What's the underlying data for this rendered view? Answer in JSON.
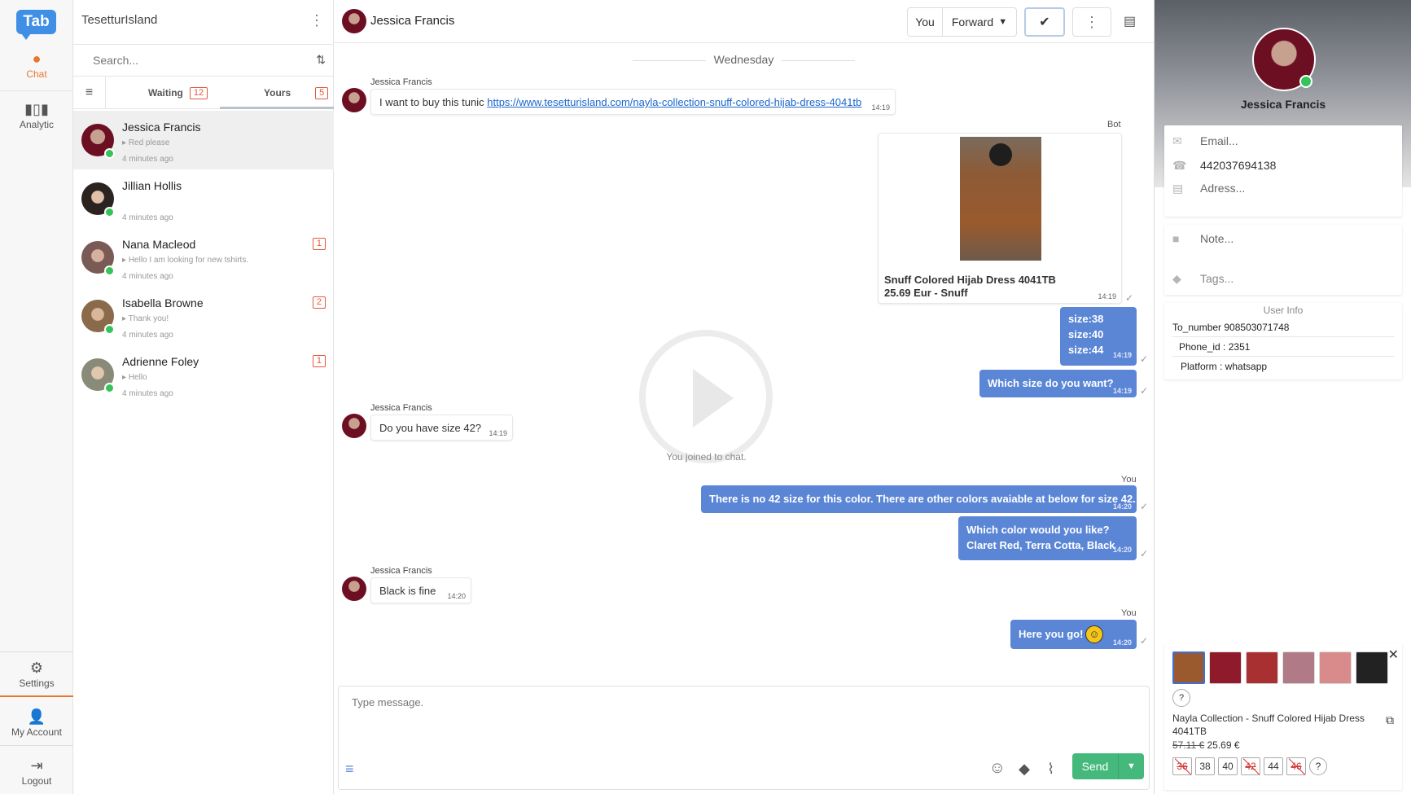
{
  "app": {
    "logo_text": "Tab"
  },
  "nav": {
    "chat": "Chat",
    "analytic": "Analytic",
    "settings": "Settings",
    "my_account": "My Account",
    "logout": "Logout"
  },
  "list": {
    "workspace": "TesetturIsland",
    "search_placeholder": "Search...",
    "tabs": [
      {
        "label": "Waiting",
        "count": "12"
      },
      {
        "label": "Yours",
        "count": "5"
      }
    ],
    "conversations": [
      {
        "name": "Jessica Francis",
        "preview": "Red please",
        "time": "4 minutes ago",
        "badge": ""
      },
      {
        "name": "Jillian Hollis",
        "preview": "",
        "time": "4 minutes ago",
        "badge": ""
      },
      {
        "name": "Nana Macleod",
        "preview": "Hello I am looking for new tshirts.",
        "time": "4 minutes ago",
        "badge": "1"
      },
      {
        "name": "Isabella Browne",
        "preview": "Thank you!",
        "time": "4 minutes ago",
        "badge": "2"
      },
      {
        "name": "Adrienne Foley",
        "preview": "Hello",
        "time": "4 minutes ago",
        "badge": "1"
      }
    ]
  },
  "chat": {
    "contact_name": "Jessica Francis",
    "assign_you": "You",
    "forward": "Forward",
    "day": "Wednesday",
    "joined": "You joined to chat.",
    "messages": {
      "m1_sender": "Jessica Francis",
      "m1_text": "I want to buy this tunic ",
      "m1_link": "https://www.tesetturisland.com/nayla-collection-snuff-colored-hijab-dress-4041tb",
      "m1_time": "14:19",
      "bot_label": "Bot",
      "product_name": "Snuff Colored Hijab Dress 4041TB",
      "product_price": "25.69 Eur - Snuff",
      "product_time": "14:19",
      "sizes_1": "size:38",
      "sizes_2": "size:40",
      "sizes_3": "size:44",
      "sizes_time": "14:19",
      "which_size": "Which size do you want?",
      "which_size_time": "14:19",
      "m2_sender": "Jessica Francis",
      "m2_text": "Do you have size 42?",
      "m2_time": "14:19",
      "you_label_1": "You",
      "no42": "There is no 42 size for this color. There are other colors avaiable at below for size 42.",
      "no42_time": "14:20",
      "which_color_1": "Which color would you like?",
      "which_color_2": "Claret Red, Terra Cotta, Black",
      "which_color_time": "14:20",
      "m3_sender": "Jessica Francis",
      "m3_text": "Black is fine",
      "m3_time": "14:20",
      "you_label_2": "You",
      "here": "Here you go!",
      "here_time": "14:20"
    },
    "composer_placeholder": "Type message.",
    "send": "Send"
  },
  "profile": {
    "name": "Jessica Francis",
    "email_placeholder": "Email...",
    "phone": "442037694138",
    "address_placeholder": "Adress...",
    "note_placeholder": "Note...",
    "tags_placeholder": "Tags...",
    "user_info_title": "User Info",
    "to_number": "To_number  908503071748",
    "phone_id": "Phone_id :  2351",
    "platform": "Platform :  whatsapp"
  },
  "product": {
    "title": "Nayla Collection - Snuff Colored Hijab Dress 4041TB",
    "old_price": "57.11 €",
    "new_price": " 25.69 €",
    "sizes": [
      "36",
      "38",
      "40",
      "42",
      "44",
      "46"
    ],
    "unavailable": [
      "36",
      "42",
      "46"
    ],
    "swatches": [
      "#9a5a2e",
      "#8e1a2c",
      "#a83030",
      "#b07a86",
      "#d98a8a",
      "#222222"
    ]
  },
  "colors": {
    "accent": "#e8772e",
    "bubble_out": "#5b86d6",
    "send": "#45b97c",
    "whatsapp": "#36c35b"
  }
}
